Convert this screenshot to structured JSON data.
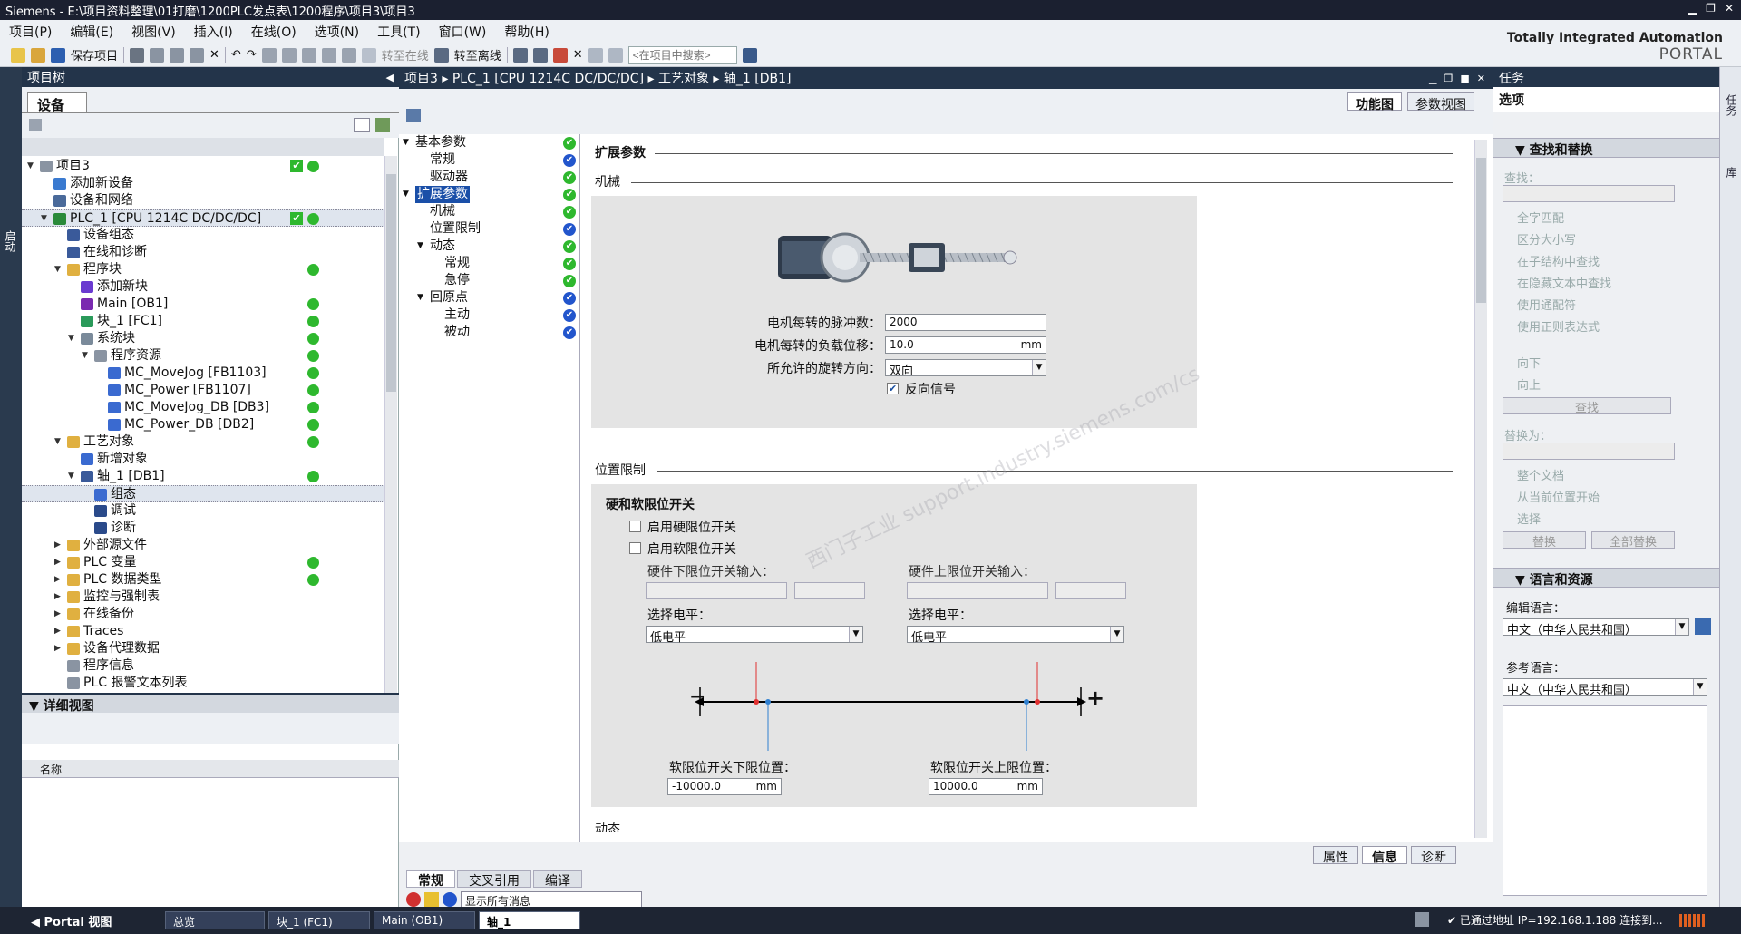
{
  "window": {
    "title": "Siemens  -  E:\\项目资料整理\\01打磨\\1200PLC发点表\\1200程序\\项目3\\项目3"
  },
  "menu": [
    "项目(P)",
    "编辑(E)",
    "视图(V)",
    "插入(I)",
    "在线(O)",
    "选项(N)",
    "工具(T)",
    "窗口(W)",
    "帮助(H)"
  ],
  "toolbar": {
    "save_project": "保存项目",
    "go_online": "转至在线",
    "go_offline": "转至离线",
    "search_placeholder": "<在项目中搜索>"
  },
  "brand": {
    "line1": "Totally Integrated Automation",
    "line2": "PORTAL"
  },
  "left_tab": "启动",
  "project_tree": {
    "header": "项目树",
    "devices_tab": "设备",
    "items": [
      {
        "label": "项目3",
        "depth": 0,
        "arrow": "▼",
        "check": true,
        "dot": true
      },
      {
        "label": "添加新设备",
        "depth": 1,
        "arrow": ""
      },
      {
        "label": "设备和网络",
        "depth": 1,
        "arrow": ""
      },
      {
        "label": "PLC_1 [CPU 1214C DC/DC/DC]",
        "depth": 1,
        "arrow": "▼",
        "check": true,
        "dot": true,
        "highlight": true
      },
      {
        "label": "设备组态",
        "depth": 2,
        "arrow": ""
      },
      {
        "label": "在线和诊断",
        "depth": 2,
        "arrow": ""
      },
      {
        "label": "程序块",
        "depth": 2,
        "arrow": "▼",
        "dot": true
      },
      {
        "label": "添加新块",
        "depth": 3,
        "arrow": ""
      },
      {
        "label": "Main [OB1]",
        "depth": 3,
        "arrow": "",
        "dot": true
      },
      {
        "label": "块_1 [FC1]",
        "depth": 3,
        "arrow": "",
        "dot": true
      },
      {
        "label": "系统块",
        "depth": 3,
        "arrow": "▼",
        "dot": true
      },
      {
        "label": "程序资源",
        "depth": 4,
        "arrow": "▼",
        "dot": true
      },
      {
        "label": "MC_MoveJog [FB1103]",
        "depth": 5,
        "arrow": "",
        "dot": true
      },
      {
        "label": "MC_Power [FB1107]",
        "depth": 5,
        "arrow": "",
        "dot": true
      },
      {
        "label": "MC_MoveJog_DB [DB3]",
        "depth": 5,
        "arrow": "",
        "dot": true
      },
      {
        "label": "MC_Power_DB [DB2]",
        "depth": 5,
        "arrow": "",
        "dot": true
      },
      {
        "label": "工艺对象",
        "depth": 2,
        "arrow": "▼",
        "dot": true
      },
      {
        "label": "新增对象",
        "depth": 3,
        "arrow": ""
      },
      {
        "label": "轴_1 [DB1]",
        "depth": 3,
        "arrow": "▼",
        "dot": true
      },
      {
        "label": "组态",
        "depth": 4,
        "arrow": "",
        "selected": true
      },
      {
        "label": "调试",
        "depth": 4,
        "arrow": ""
      },
      {
        "label": "诊断",
        "depth": 4,
        "arrow": ""
      },
      {
        "label": "外部源文件",
        "depth": 2,
        "arrow": "▶"
      },
      {
        "label": "PLC 变量",
        "depth": 2,
        "arrow": "▶",
        "dot": true
      },
      {
        "label": "PLC 数据类型",
        "depth": 2,
        "arrow": "▶",
        "dot": true
      },
      {
        "label": "监控与强制表",
        "depth": 2,
        "arrow": "▶"
      },
      {
        "label": "在线备份",
        "depth": 2,
        "arrow": "▶"
      },
      {
        "label": "Traces",
        "depth": 2,
        "arrow": "▶"
      },
      {
        "label": "设备代理数据",
        "depth": 2,
        "arrow": "▶"
      },
      {
        "label": "程序信息",
        "depth": 2,
        "arrow": ""
      },
      {
        "label": "PLC 报警文本列表",
        "depth": 2,
        "arrow": ""
      }
    ]
  },
  "detail_view": {
    "header": "详细视图",
    "col_name": "名称"
  },
  "editor": {
    "breadcrumb": [
      "项目3",
      "PLC_1 [CPU 1214C DC/DC/DC]",
      "工艺对象",
      "轴_1 [DB1]"
    ],
    "view_tabs": [
      "功能图",
      "参数视图"
    ],
    "nav": [
      {
        "label": "基本参数",
        "depth": 0,
        "arrow": "▼",
        "status": "g"
      },
      {
        "label": "常规",
        "depth": 1,
        "arrow": "",
        "status": "b"
      },
      {
        "label": "驱动器",
        "depth": 1,
        "arrow": "",
        "status": "g"
      },
      {
        "label": "扩展参数",
        "depth": 0,
        "arrow": "▼",
        "status": "g",
        "selected": true
      },
      {
        "label": "机械",
        "depth": 1,
        "arrow": "",
        "status": "g"
      },
      {
        "label": "位置限制",
        "depth": 1,
        "arrow": "",
        "status": "b"
      },
      {
        "label": "动态",
        "depth": 1,
        "arrow": "▼",
        "status": "g"
      },
      {
        "label": "常规",
        "depth": 2,
        "arrow": "",
        "status": "g"
      },
      {
        "label": "急停",
        "depth": 2,
        "arrow": "",
        "status": "g"
      },
      {
        "label": "回原点",
        "depth": 1,
        "arrow": "▼",
        "status": "b"
      },
      {
        "label": "主动",
        "depth": 2,
        "arrow": "",
        "status": "b"
      },
      {
        "label": "被动",
        "depth": 2,
        "arrow": "",
        "status": "b"
      }
    ],
    "section_title": "扩展参数",
    "mech": {
      "title": "机械",
      "pulses_label": "电机每转的脉冲数：",
      "pulses_value": "2000",
      "disp_label": "电机每转的负载位移：",
      "disp_value": "10.0",
      "disp_unit": "mm",
      "dir_label": "所允许的旋转方向：",
      "dir_value": "双向",
      "invert_label": "反向信号",
      "invert_checked": true
    },
    "poslimit": {
      "title": "位置限制",
      "group_title": "硬和软限位开关",
      "enable_hw": "启用硬限位开关",
      "enable_sw": "启用软限位开关",
      "hw_low_label": "硬件下限位开关输入：",
      "hw_high_label": "硬件上限位开关输入：",
      "level_label": "选择电平：",
      "level_low": "低电平",
      "level_high": "低电平",
      "minus": "−",
      "plus": "+",
      "sw_low_label": "软限位开关下限位置：",
      "sw_low_value": "-10000.0",
      "sw_high_label": "软限位开关上限位置：",
      "sw_high_value": "10000.0",
      "unit": "mm"
    },
    "dyn_title": "动态",
    "watermark": "西门子工业 support.industry.siemens.com/cs"
  },
  "bottom": {
    "inspector_tabs": [
      "属性",
      "信息",
      "诊断"
    ],
    "tabs": [
      "常规",
      "交叉引用",
      "编译"
    ],
    "filter": "显示所有消息"
  },
  "tasks": {
    "header": "任务",
    "options": "选项",
    "find_replace": "查找和替换",
    "find_label": "查找：",
    "whole_word": "全字匹配",
    "match_case": "区分大小写",
    "sub_struct": "在子结构中查找",
    "hidden_text": "在隐藏文本中查找",
    "wildcards": "使用通配符",
    "regex": "使用正则表达式",
    "down": "向下",
    "up": "向上",
    "find_btn": "查找",
    "replace_label": "替换为：",
    "whole_doc": "整个文档",
    "from_current": "从当前位置开始",
    "selection": "选择",
    "replace_btn": "替换",
    "replace_all_btn": "全部替换",
    "lang_res": "语言和资源",
    "edit_lang_label": "编辑语言：",
    "edit_lang": "中文（中华人民共和国）",
    "ref_lang_label": "参考语言：",
    "ref_lang": "中文（中华人民共和国）"
  },
  "right_tabs": [
    "任务",
    "库"
  ],
  "status": {
    "portal": "Portal 视图",
    "overview": "总览",
    "tab_fc1": "块_1 (FC1)",
    "tab_main": "Main (OB1)",
    "tab_axis": "轴_1",
    "connection": "已通过地址 IP=192.168.1.188 连接到..."
  }
}
